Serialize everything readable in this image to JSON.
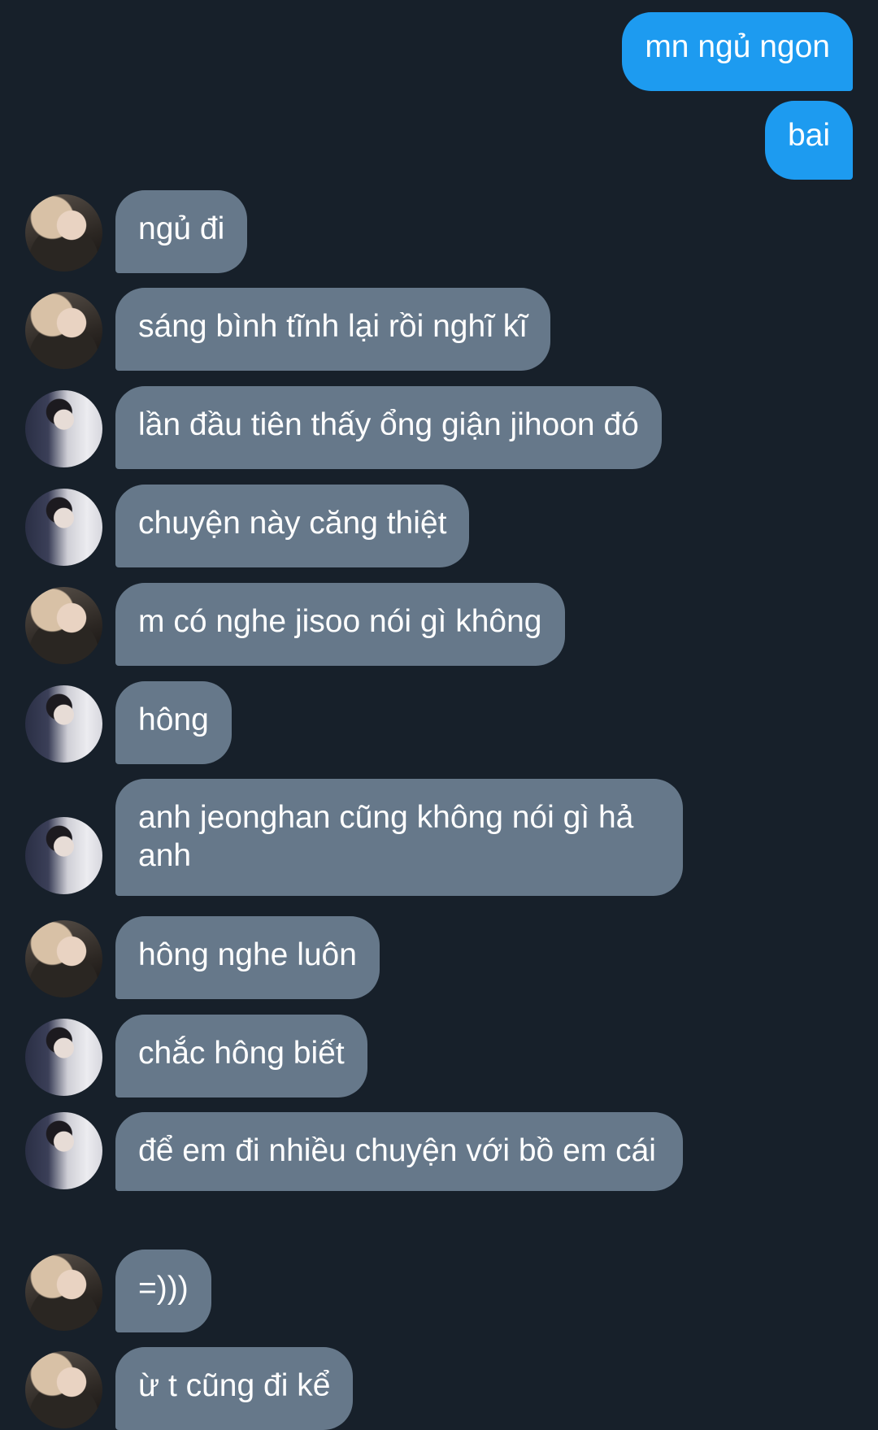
{
  "messages": [
    {
      "id": 0,
      "side": "out",
      "text": "mn ngủ ngon"
    },
    {
      "id": 1,
      "side": "out",
      "text": "bai"
    },
    {
      "id": 2,
      "side": "in",
      "avatar": "a",
      "text": "ngủ đi"
    },
    {
      "id": 3,
      "side": "in",
      "avatar": "a",
      "text": "sáng bình tĩnh lại rồi nghĩ kĩ"
    },
    {
      "id": 4,
      "side": "in",
      "avatar": "b",
      "text": "lần đầu tiên thấy ổng giận jihoon đó"
    },
    {
      "id": 5,
      "side": "in",
      "avatar": "b",
      "text": "chuyện này căng thiệt"
    },
    {
      "id": 6,
      "side": "in",
      "avatar": "a",
      "text": "m có nghe jisoo nói gì không"
    },
    {
      "id": 7,
      "side": "in",
      "avatar": "b",
      "text": "hông"
    },
    {
      "id": 8,
      "side": "in",
      "avatar": "b",
      "text": "anh jeonghan cũng không nói gì hả anh"
    },
    {
      "id": 9,
      "side": "in",
      "avatar": "a",
      "text": "hông nghe luôn"
    },
    {
      "id": 10,
      "side": "in",
      "avatar": "b",
      "text": "chắc hông biết"
    },
    {
      "id": 11,
      "side": "in",
      "avatar": "b",
      "text": "để em đi nhiều chuyện với bồ em cái"
    },
    {
      "id": 12,
      "side": "in",
      "avatar": "a",
      "text": "=)))"
    },
    {
      "id": 13,
      "side": "in",
      "avatar": "a",
      "text": "ừ t cũng đi kể"
    }
  ],
  "colors": {
    "background": "#17202a",
    "outgoing_bubble": "#1d9bf0",
    "incoming_bubble": "#66788a",
    "text": "#ffffff"
  }
}
